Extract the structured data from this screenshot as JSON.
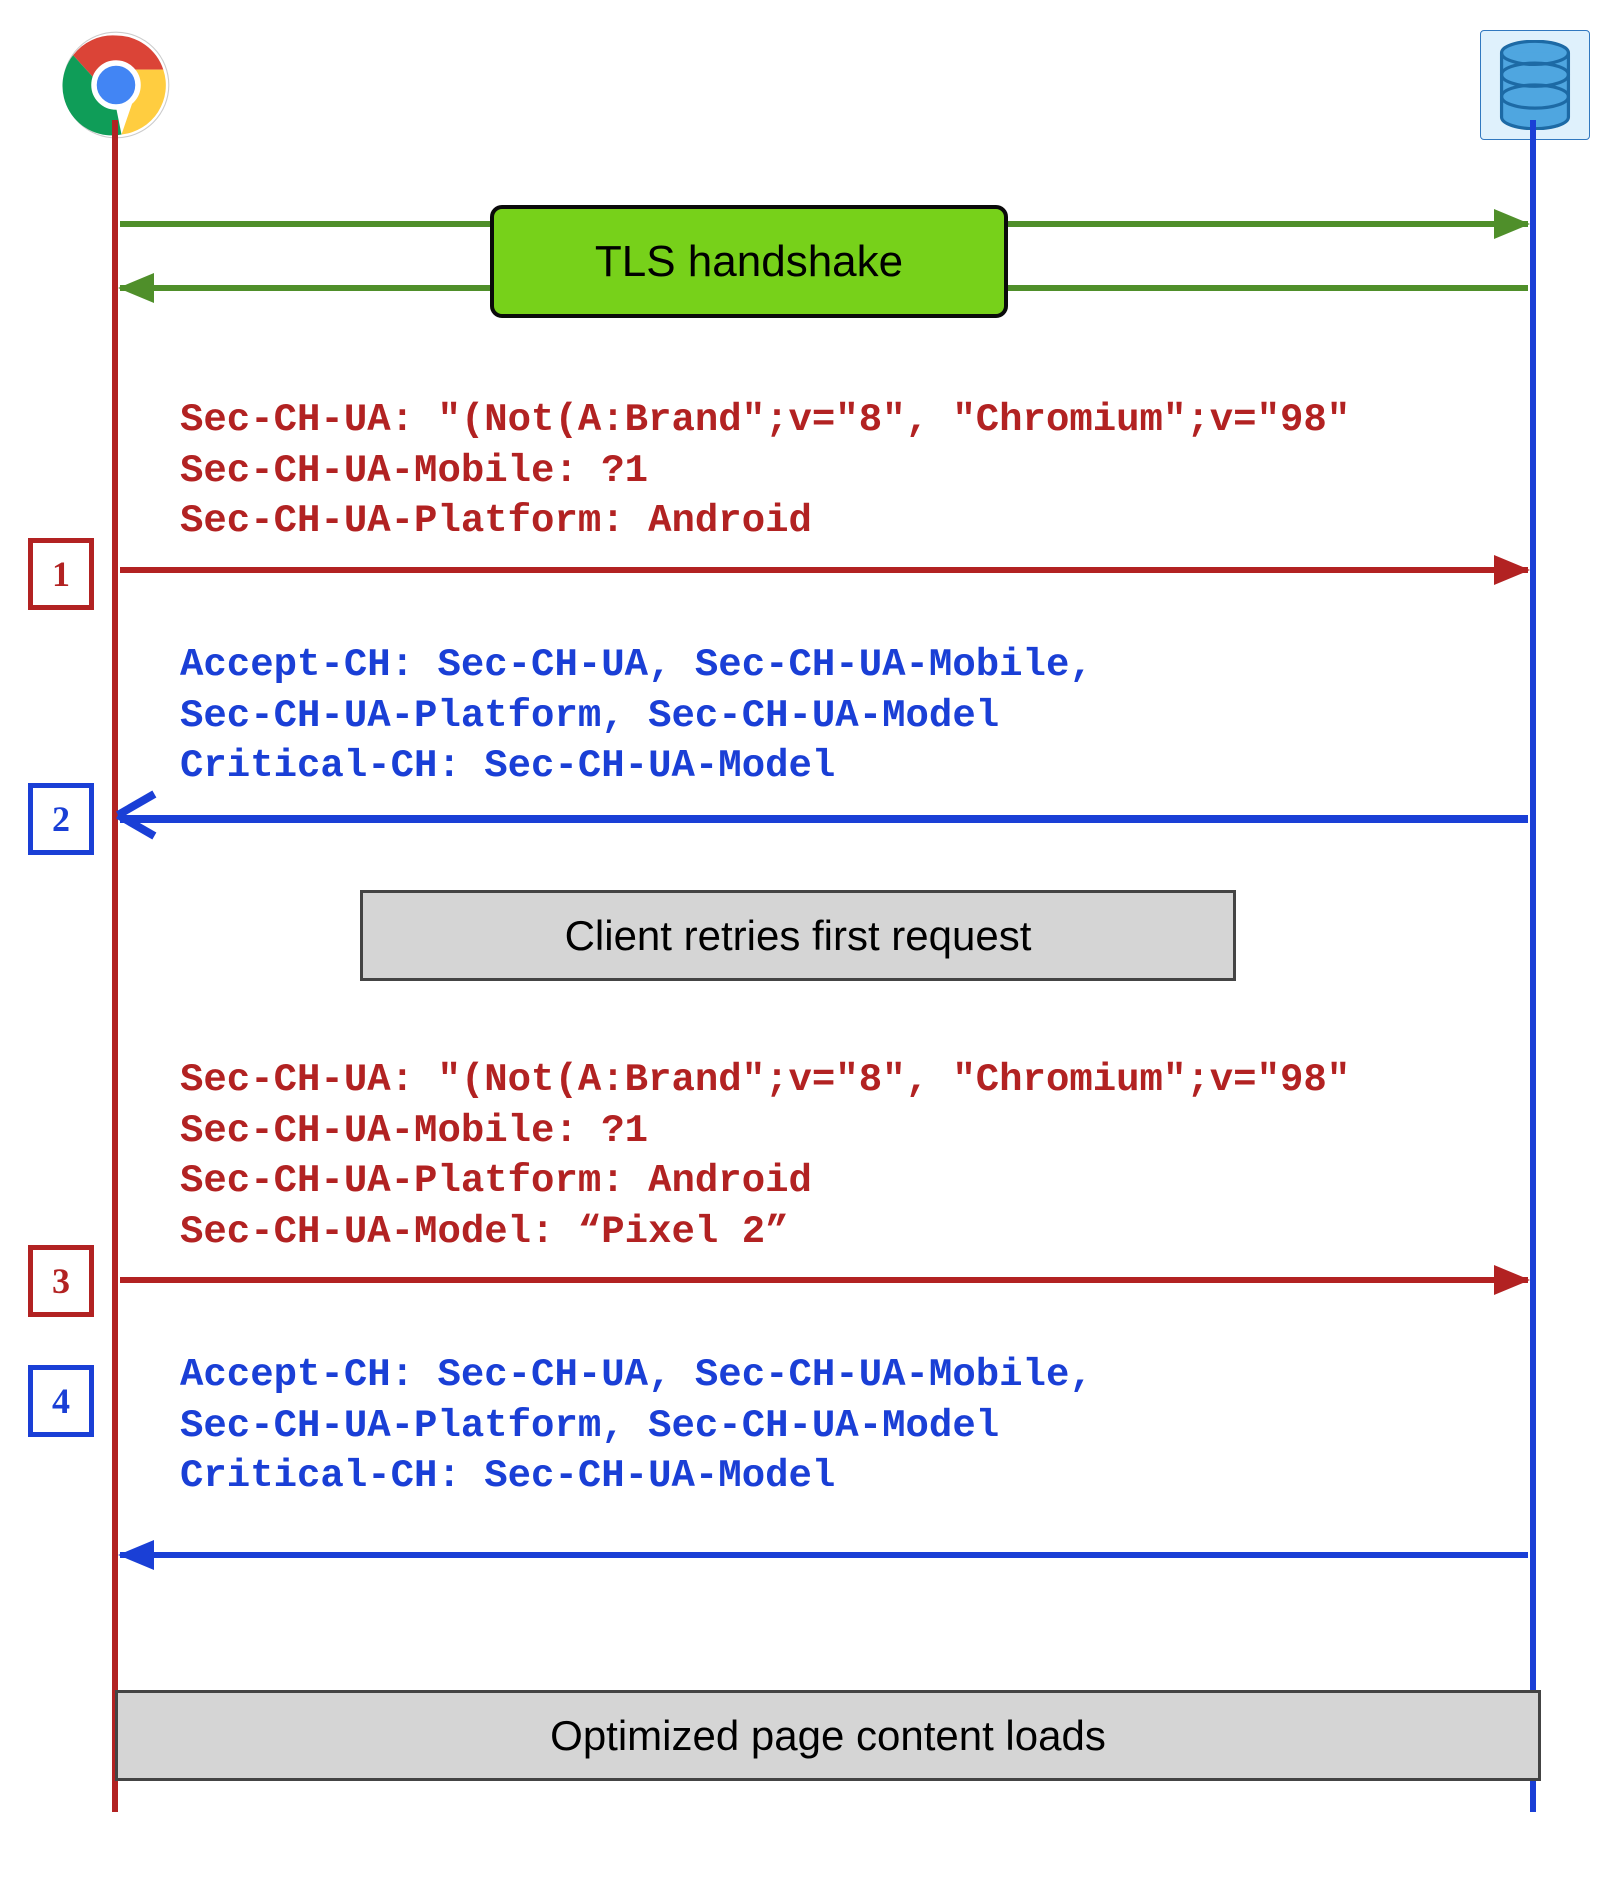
{
  "participants": {
    "client": {
      "icon": "chrome-icon"
    },
    "server": {
      "icon": "database-icon"
    }
  },
  "tls_label": "TLS handshake",
  "steps": {
    "s1": {
      "num": "1",
      "color": "red"
    },
    "s2": {
      "num": "2",
      "color": "blue"
    },
    "s3": {
      "num": "3",
      "color": "red"
    },
    "s4": {
      "num": "4",
      "color": "blue"
    }
  },
  "headers": {
    "req1": "Sec-CH-UA: \"(Not(A:Brand\";v=\"8\", \"Chromium\";v=\"98\"\nSec-CH-UA-Mobile: ?1\nSec-CH-UA-Platform: Android",
    "res1": "Accept-CH: Sec-CH-UA, Sec-CH-UA-Mobile,\nSec-CH-UA-Platform, Sec-CH-UA-Model\nCritical-CH: Sec-CH-UA-Model",
    "req2": "Sec-CH-UA: \"(Not(A:Brand\";v=\"8\", \"Chromium\";v=\"98\"\nSec-CH-UA-Mobile: ?1\nSec-CH-UA-Platform: Android\nSec-CH-UA-Model: “Pixel 2”",
    "res2": "Accept-CH: Sec-CH-UA, Sec-CH-UA-Mobile,\nSec-CH-UA-Platform, Sec-CH-UA-Model\nCritical-CH: Sec-CH-UA-Model"
  },
  "notes": {
    "retry": "Client retries first request",
    "loads": "Optimized page content loads"
  }
}
